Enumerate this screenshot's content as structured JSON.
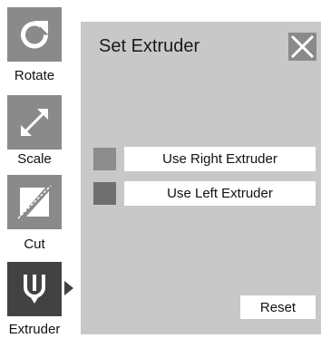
{
  "toolbar": {
    "items": [
      {
        "label": "Rotate",
        "icon": "rotate-icon"
      },
      {
        "label": "Scale",
        "icon": "scale-icon"
      },
      {
        "label": "Cut",
        "icon": "cut-icon"
      },
      {
        "label": "Extruder",
        "icon": "extruder-icon",
        "active": true
      }
    ]
  },
  "panel": {
    "title": "Set Extruder",
    "close_icon": "close-icon",
    "options": [
      {
        "label": "Use Right Extruder",
        "swatch_color": "#8d8d8d"
      },
      {
        "label": "Use Left Extruder",
        "swatch_color": "#6f6f6f"
      }
    ],
    "reset_label": "Reset"
  },
  "colors": {
    "tool_bg": "#8a8a8a",
    "tool_active_bg": "#424242",
    "panel_bg": "#c8c8c8",
    "button_bg": "#ffffff"
  }
}
